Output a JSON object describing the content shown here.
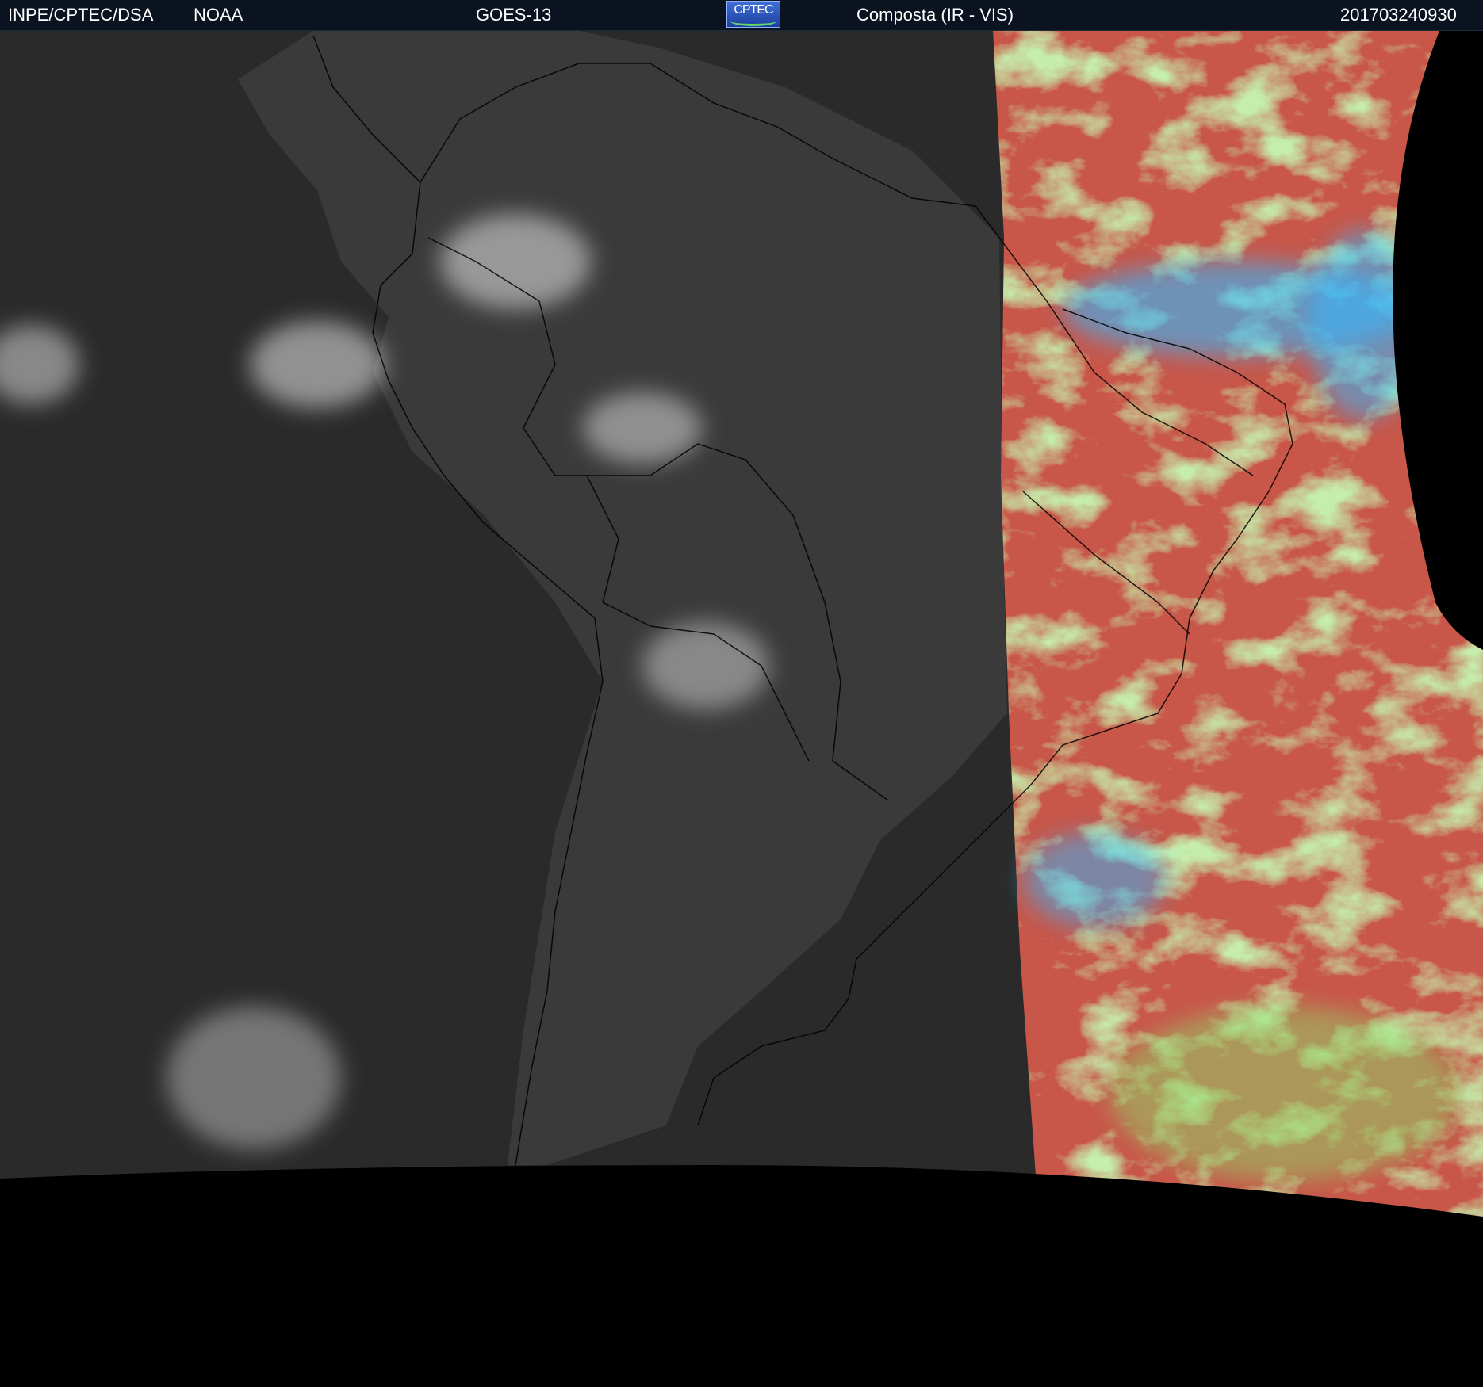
{
  "header": {
    "agency": "INPE/CPTEC/DSA",
    "source": "NOAA",
    "satellite": "GOES-13",
    "logo_text": "CPTEC",
    "product": "Composta (IR - VIS)",
    "timestamp": "201703240930"
  },
  "colors": {
    "header_background": "#0b1220",
    "header_text": "#ffffff",
    "ocean_ir": "#2a2a2a",
    "land_ir": "#3a3a3a",
    "cloud": "#e6e6e6",
    "vis_red": "#c8574a",
    "vis_green": "#8fd86a",
    "vis_cyan": "#33b8ff",
    "outside_disk": "#000000"
  }
}
